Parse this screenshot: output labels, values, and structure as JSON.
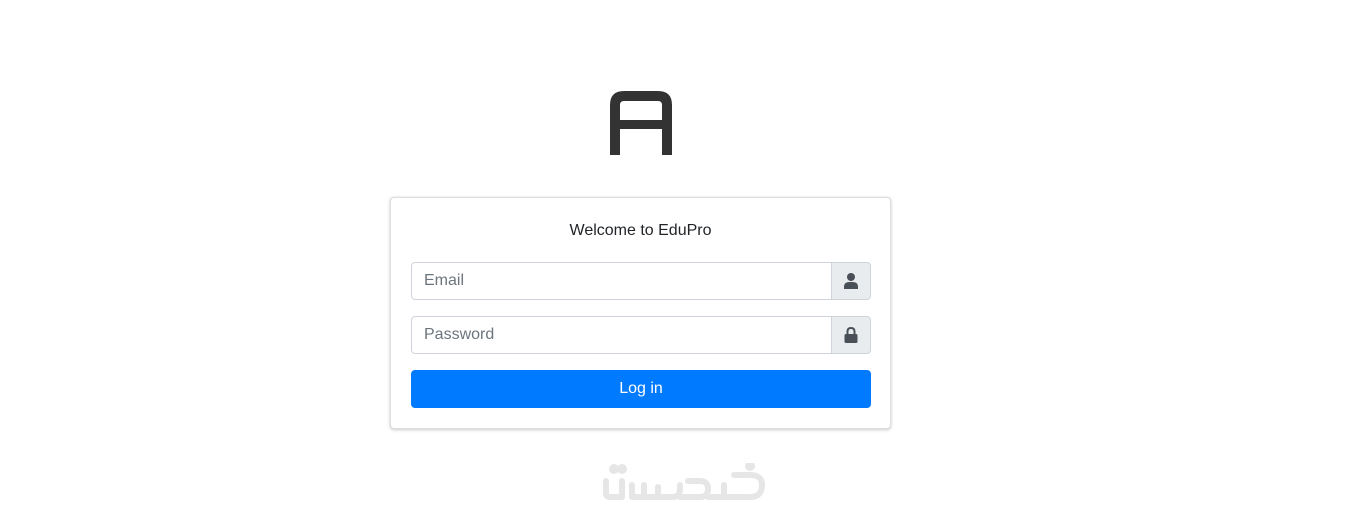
{
  "logo": {
    "icon": "logo-letter-a-icon",
    "color": "#333333"
  },
  "login_box": {
    "message": "Welcome to EduPro",
    "email": {
      "placeholder": "Email",
      "value": "",
      "icon": "user-icon"
    },
    "password": {
      "placeholder": "Password",
      "value": "",
      "icon": "lock-icon"
    },
    "submit_label": "Log in"
  },
  "watermark": {
    "text": "خمسات",
    "color": "#e6e6e6"
  },
  "colors": {
    "primary": "#007bff",
    "addon_bg": "#e9ecef",
    "addon_icon": "#495057",
    "border": "#ced4da",
    "text": "#212529"
  }
}
